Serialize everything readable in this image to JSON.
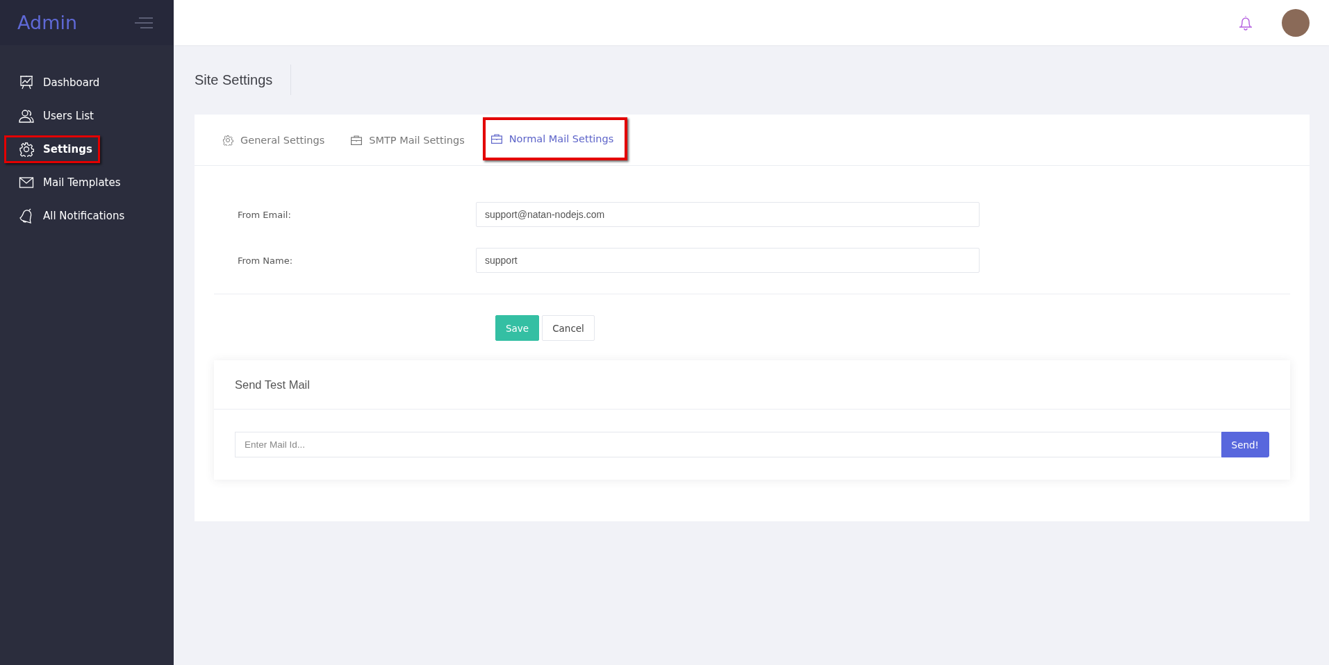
{
  "sidebar": {
    "logo": "Admin",
    "items": [
      {
        "label": "Dashboard",
        "selected": false,
        "highlighted": false
      },
      {
        "label": "Users List",
        "selected": false,
        "highlighted": false
      },
      {
        "label": "Settings",
        "selected": true,
        "highlighted": true
      },
      {
        "label": "Mail Templates",
        "selected": false,
        "highlighted": false
      },
      {
        "label": "All Notifications",
        "selected": false,
        "highlighted": false
      }
    ]
  },
  "page_title": "Site Settings",
  "tabs": [
    {
      "label": "General Settings",
      "selected": false,
      "highlighted": false
    },
    {
      "label": "SMTP Mail Settings",
      "selected": false,
      "highlighted": false
    },
    {
      "label": "Normal Mail Settings",
      "selected": true,
      "highlighted": true
    }
  ],
  "form": {
    "fields": [
      {
        "label": "From Email:",
        "value": "support@natan-nodejs.com"
      },
      {
        "label": "From Name:",
        "value": "support"
      }
    ],
    "buttons": [
      {
        "label": "Save",
        "kind": "primary"
      },
      {
        "label": "Cancel",
        "kind": "secondary"
      }
    ]
  },
  "test_mail": {
    "title": "Send Test Mail",
    "placeholder": "Enter Mail Id...",
    "button": "Send!"
  }
}
